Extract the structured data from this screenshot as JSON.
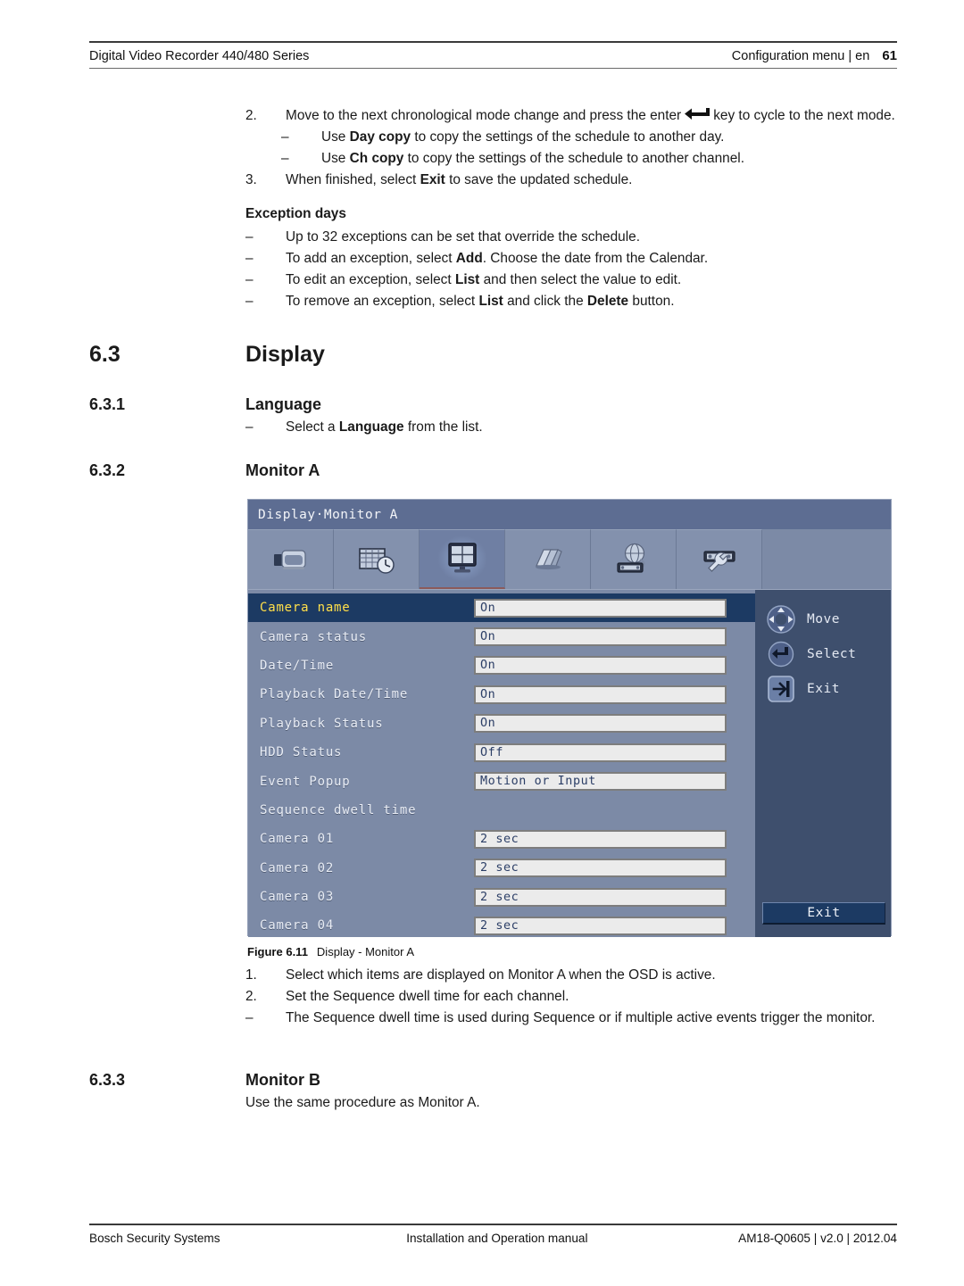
{
  "header": {
    "left": "Digital Video Recorder 440/480 Series",
    "right": "Configuration menu | en",
    "page_number": "61"
  },
  "body": {
    "step2": {
      "number": "2.",
      "text_before": "Move to the next chronological mode change and press the enter",
      "icon": "enter-key-icon",
      "text_after": "key to cycle to the next mode."
    },
    "step2_subs": [
      {
        "marker": "–",
        "before": "Use ",
        "bold": "Day copy",
        "after": " to copy the settings of the schedule to another day."
      },
      {
        "marker": "–",
        "before": "Use ",
        "bold": "Ch copy",
        "after": " to copy the settings of the schedule to another channel."
      }
    ],
    "step3": {
      "number": "3.",
      "before": "When finished, select ",
      "bold": "Exit",
      "after": " to save the updated schedule."
    },
    "exception_heading": "Exception days",
    "exception_items": [
      {
        "marker": "–",
        "before": "Up to 32 exceptions can be set that override the schedule.",
        "bold": "",
        "after": ""
      },
      {
        "marker": "–",
        "before": "To add an exception, select ",
        "bold": "Add",
        "after": ". Choose the date from the Calendar."
      },
      {
        "marker": "–",
        "before": "To edit an exception, select ",
        "bold": "List",
        "after": " and then select the value to edit."
      },
      {
        "marker": "–",
        "before": "To remove an exception, select ",
        "bold": "List",
        "after": " and click the ",
        "bold2": "Delete",
        "after2": " button."
      }
    ]
  },
  "sections": {
    "s63": {
      "number": "6.3",
      "title": "Display"
    },
    "s631": {
      "number": "6.3.1",
      "title": "Language"
    },
    "s631_item": {
      "marker": "–",
      "before": "Select a ",
      "bold": "Language",
      "after": " from the list."
    },
    "s632": {
      "number": "6.3.2",
      "title": "Monitor A"
    },
    "s633": {
      "number": "6.3.3",
      "title": "Monitor B",
      "body": "Use the same procedure as Monitor A."
    }
  },
  "osd": {
    "title": "Display·Monitor A",
    "tabs": [
      {
        "name": "camera-tab",
        "icon": "camcorder-icon",
        "selected": false
      },
      {
        "name": "schedule-tab",
        "icon": "calendar-clock-icon",
        "selected": false
      },
      {
        "name": "display-tab",
        "icon": "monitor-quad-icon",
        "selected": true
      },
      {
        "name": "event-tab",
        "icon": "alarm-horn-icon",
        "selected": false
      },
      {
        "name": "network-tab",
        "icon": "globe-network-icon",
        "selected": false
      },
      {
        "name": "system-tab",
        "icon": "wrench-device-icon",
        "selected": false
      }
    ],
    "rows": [
      {
        "label": "Camera name",
        "value": "On",
        "has_field": true,
        "highlight": true
      },
      {
        "label": "Camera status",
        "value": "On",
        "has_field": true,
        "highlight": false
      },
      {
        "label": "Date/Time",
        "value": "On",
        "has_field": true,
        "highlight": false
      },
      {
        "label": "Playback Date/Time",
        "value": "On",
        "has_field": true,
        "highlight": false
      },
      {
        "label": "Playback Status",
        "value": "On",
        "has_field": true,
        "highlight": false
      },
      {
        "label": "HDD Status",
        "value": "Off",
        "has_field": true,
        "highlight": false
      },
      {
        "label": "Event Popup",
        "value": "Motion or Input",
        "has_field": true,
        "highlight": false
      },
      {
        "label": "Sequence dwell time",
        "value": "",
        "has_field": false,
        "highlight": false
      },
      {
        "label": "Camera 01",
        "value": "2 sec",
        "has_field": true,
        "highlight": false
      },
      {
        "label": "Camera 02",
        "value": "2 sec",
        "has_field": true,
        "highlight": false
      },
      {
        "label": "Camera 03",
        "value": "2 sec",
        "has_field": true,
        "highlight": false
      },
      {
        "label": "Camera 04",
        "value": "2 sec",
        "has_field": true,
        "highlight": false
      }
    ],
    "hints": [
      {
        "icon": "dpad-icon",
        "label": "Move"
      },
      {
        "icon": "enter-key-icon",
        "label": "Select"
      },
      {
        "icon": "exit-door-icon",
        "label": "Exit"
      }
    ],
    "exit_button": "Exit",
    "colors": {
      "panel_bg": "#7c8aa6",
      "titlebar": "#5d6d92",
      "side_panel": "#3e4f6d",
      "highlight_row": "#1c3a63",
      "highlight_text": "#ffe14d",
      "field_bg": "#ebebeb",
      "field_text": "#2b3e66"
    }
  },
  "figure": {
    "label": "Figure 6.11",
    "caption": "Display - Monitor A"
  },
  "post_figure": [
    {
      "marker": "1.",
      "text": "Select which items are displayed on Monitor A when the OSD is active."
    },
    {
      "marker": "2.",
      "text": "Set the Sequence dwell time for each channel."
    },
    {
      "marker": "–",
      "text": "The Sequence dwell time is used during Sequence or if multiple active events trigger the monitor."
    }
  ],
  "footer": {
    "left": "Bosch Security Systems",
    "center": "Installation and Operation manual",
    "right": "AM18-Q0605 | v2.0 | 2012.04"
  }
}
